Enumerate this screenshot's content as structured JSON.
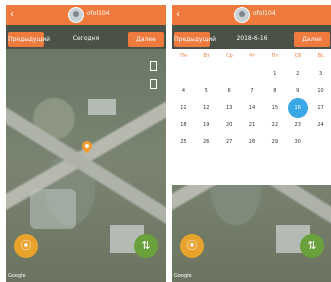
{
  "screens": {
    "left": {
      "username": "ofol104",
      "prev_label": "Предыдущий",
      "next_label": "Далее",
      "date_label": "Сегодня",
      "map_attribution": "Google"
    },
    "right": {
      "username": "ofol104",
      "prev_label": "Предыдущий",
      "next_label": "Далее",
      "date_label": "2018-6-16",
      "weekday_headers": [
        "Пн",
        "Вт",
        "Ср",
        "Чт",
        "Пт",
        "Сб",
        "Вс"
      ],
      "calendar_days": [
        "",
        "",
        "",
        "",
        "1",
        "2",
        "3",
        "4",
        "5",
        "6",
        "7",
        "8",
        "9",
        "10",
        "11",
        "12",
        "13",
        "14",
        "15",
        "16",
        "17",
        "18",
        "19",
        "20",
        "21",
        "22",
        "23",
        "24",
        "25",
        "26",
        "27",
        "28",
        "29",
        "30"
      ],
      "selected_day": "16",
      "map_attribution": "Google"
    }
  },
  "colors": {
    "accent": "#ee7a3d",
    "selected_day": "#3aa7e6",
    "location_fab": "#e8a32c",
    "swap_fab": "#6aa13c"
  }
}
